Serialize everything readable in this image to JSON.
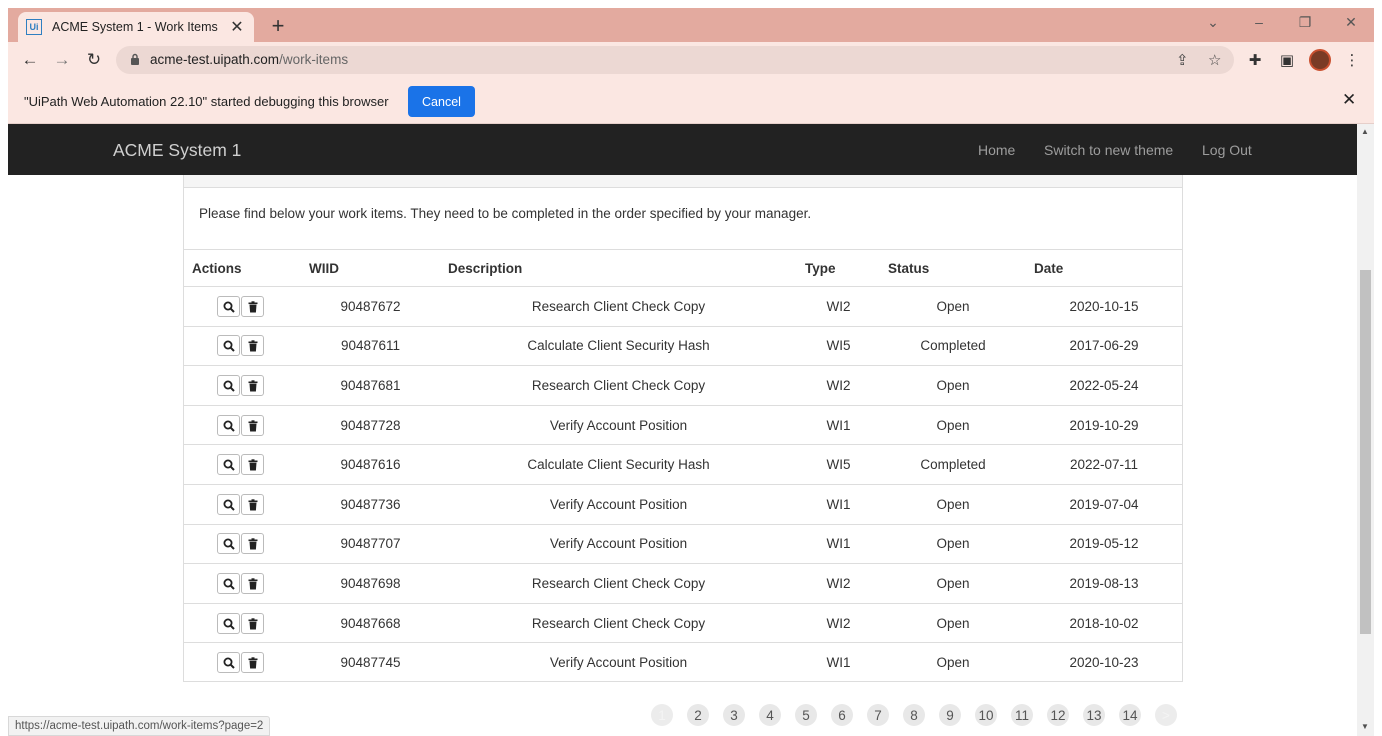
{
  "browser": {
    "tab_title": "ACME System 1 - Work Items",
    "tab_favicon": "Ui",
    "url_host": "acme-test.uipath.com",
    "url_path": "/work-items",
    "infobar_text": "\"UiPath Web Automation 22.10\" started debugging this browser",
    "infobar_cancel": "Cancel",
    "status_url": "https://acme-test.uipath.com/work-items?page=2"
  },
  "navbar": {
    "brand": "ACME System 1",
    "links": [
      "Home",
      "Switch to new theme",
      "Log Out"
    ]
  },
  "panel": {
    "message": "Please find below your work items. They need to be completed in the order specified by your manager."
  },
  "table": {
    "headers": [
      "Actions",
      "WIID",
      "Description",
      "Type",
      "Status",
      "Date"
    ],
    "rows": [
      {
        "wiid": "90487672",
        "description": "Research Client Check Copy",
        "type": "WI2",
        "status": "Open",
        "date": "2020-10-15"
      },
      {
        "wiid": "90487611",
        "description": "Calculate Client Security Hash",
        "type": "WI5",
        "status": "Completed",
        "date": "2017-06-29"
      },
      {
        "wiid": "90487681",
        "description": "Research Client Check Copy",
        "type": "WI2",
        "status": "Open",
        "date": "2022-05-24"
      },
      {
        "wiid": "90487728",
        "description": "Verify Account Position",
        "type": "WI1",
        "status": "Open",
        "date": "2019-10-29"
      },
      {
        "wiid": "90487616",
        "description": "Calculate Client Security Hash",
        "type": "WI5",
        "status": "Completed",
        "date": "2022-07-11"
      },
      {
        "wiid": "90487736",
        "description": "Verify Account Position",
        "type": "WI1",
        "status": "Open",
        "date": "2019-07-04"
      },
      {
        "wiid": "90487707",
        "description": "Verify Account Position",
        "type": "WI1",
        "status": "Open",
        "date": "2019-05-12"
      },
      {
        "wiid": "90487698",
        "description": "Research Client Check Copy",
        "type": "WI2",
        "status": "Open",
        "date": "2019-08-13"
      },
      {
        "wiid": "90487668",
        "description": "Research Client Check Copy",
        "type": "WI2",
        "status": "Open",
        "date": "2018-10-02"
      },
      {
        "wiid": "90487745",
        "description": "Verify Account Position",
        "type": "WI1",
        "status": "Open",
        "date": "2020-10-23"
      }
    ]
  },
  "pagination": {
    "pages": [
      "1",
      "2",
      "3",
      "4",
      "5",
      "6",
      "7",
      "8",
      "9",
      "10",
      "11",
      "12",
      "13",
      "14"
    ],
    "next": ">",
    "current": "1"
  },
  "colors": {
    "tabstrip": "#e3aa9f",
    "toolbar": "#fbe7e2",
    "navbar": "#222222",
    "cancel_button": "#1a73e8"
  },
  "icons": {
    "view": "magnifier-icon",
    "delete": "trash-icon"
  }
}
